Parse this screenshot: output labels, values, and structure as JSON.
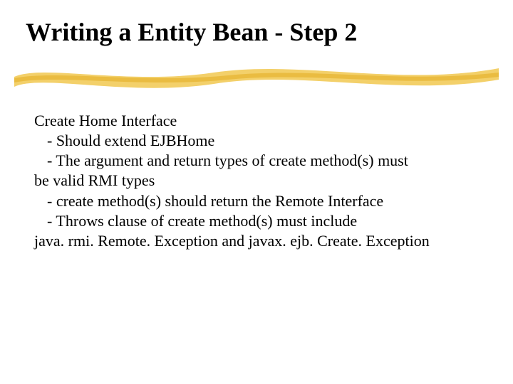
{
  "title": "Writing a Entity Bean - Step 2",
  "body": {
    "lead": "Create Home Interface",
    "points": [
      "- Should extend EJBHome",
      "- The argument and return types of create method(s) must",
      "- create method(s) should return the Remote Interface",
      "- Throws clause of create method(s) must include"
    ],
    "wrap1": "be valid RMI types",
    "wrap2": "java. rmi. Remote. Exception and javax. ejb. Create. Exception"
  },
  "colors": {
    "swash_light": "#f6d97a",
    "swash_dark": "#e8b93a"
  }
}
